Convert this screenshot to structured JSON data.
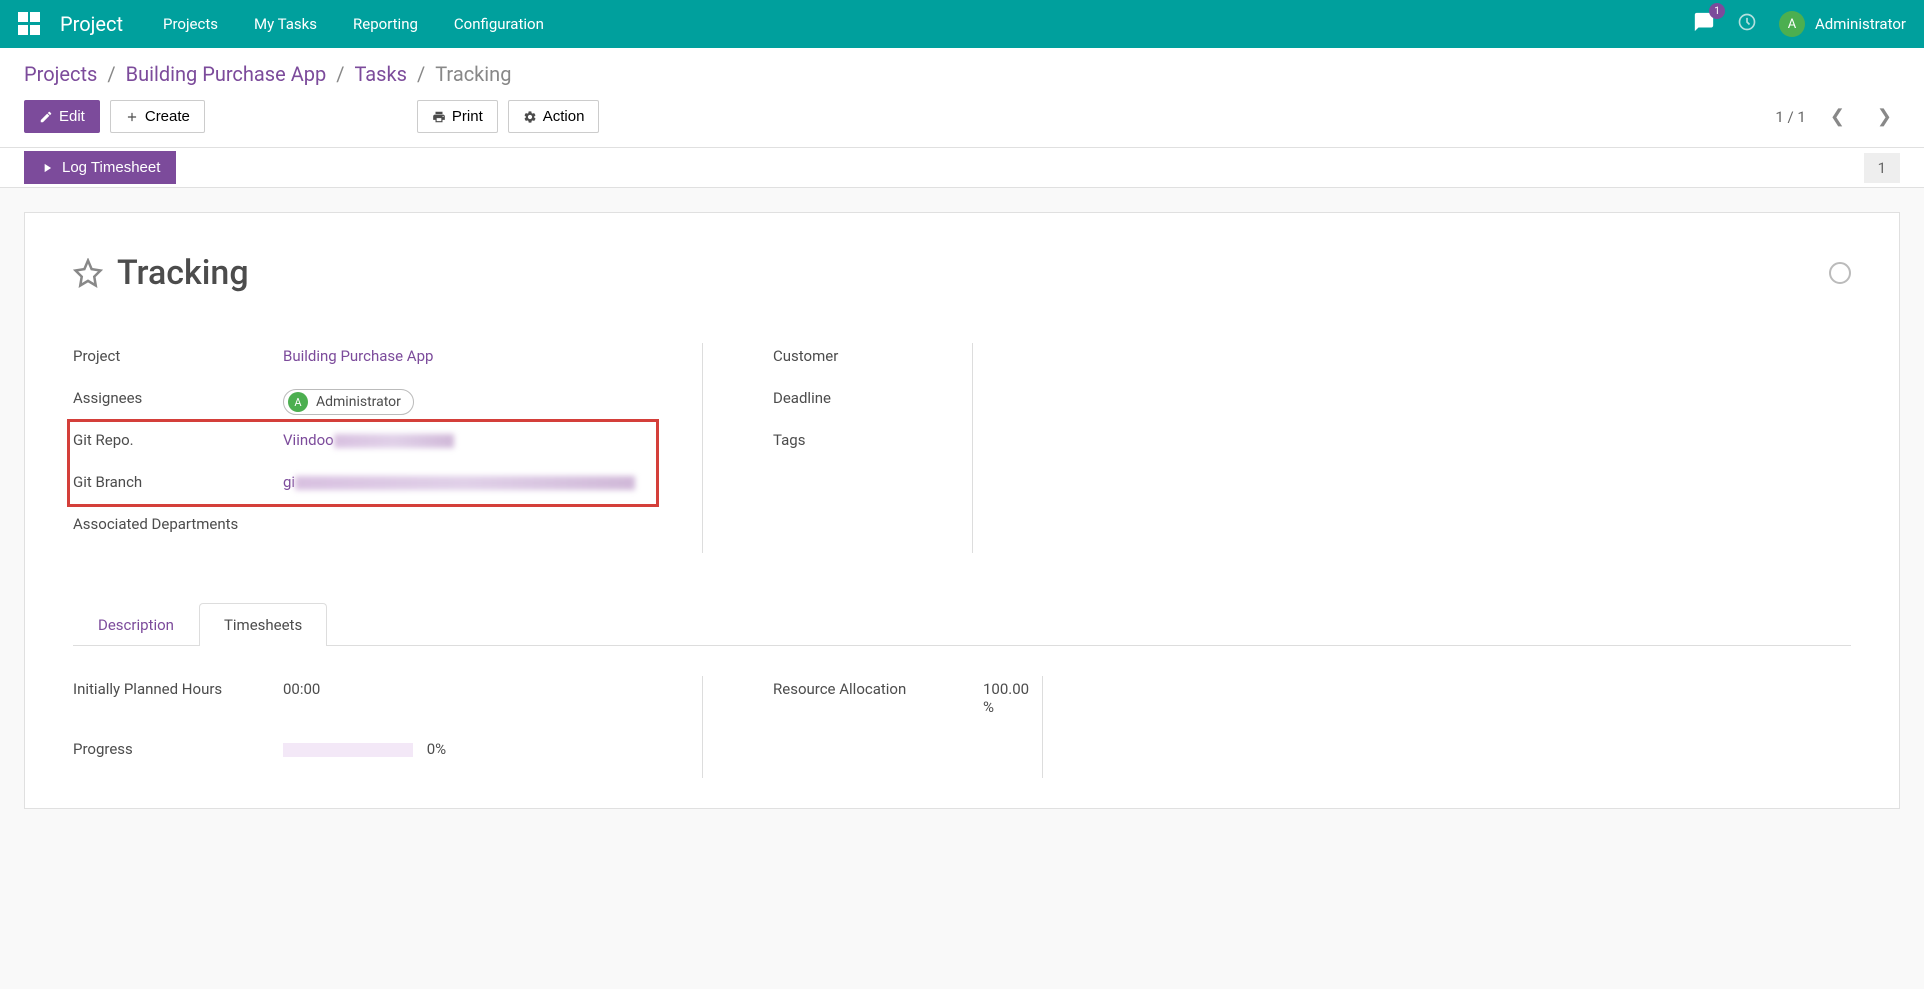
{
  "topbar": {
    "app_title": "Project",
    "nav": [
      "Projects",
      "My Tasks",
      "Reporting",
      "Configuration"
    ],
    "chat_badge": "1",
    "user_initial": "A",
    "user_name": "Administrator"
  },
  "breadcrumb": {
    "projects": "Projects",
    "project_name": "Building Purchase App",
    "tasks": "Tasks",
    "current": "Tracking"
  },
  "buttons": {
    "edit": "Edit",
    "create": "Create",
    "print": "Print",
    "action": "Action",
    "log_timesheet": "Log Timesheet"
  },
  "pager": {
    "text": "1 / 1"
  },
  "status_count": "1",
  "task": {
    "title": "Tracking",
    "fields": {
      "project_label": "Project",
      "project_value": "Building Purchase App",
      "assignees_label": "Assignees",
      "assignee_initial": "A",
      "assignee_name": "Administrator",
      "git_repo_label": "Git Repo.",
      "git_repo_prefix": "Viindoo",
      "git_branch_label": "Git Branch",
      "git_branch_prefix": "gi",
      "assoc_dept_label": "Associated Departments",
      "customer_label": "Customer",
      "deadline_label": "Deadline",
      "tags_label": "Tags"
    }
  },
  "tabs": {
    "description": "Description",
    "timesheets": "Timesheets"
  },
  "timesheet": {
    "planned_label": "Initially Planned Hours",
    "planned_value": "00:00",
    "resource_label": "Resource Allocation",
    "resource_value": "100.00 %",
    "progress_label": "Progress",
    "progress_value": "0%"
  }
}
